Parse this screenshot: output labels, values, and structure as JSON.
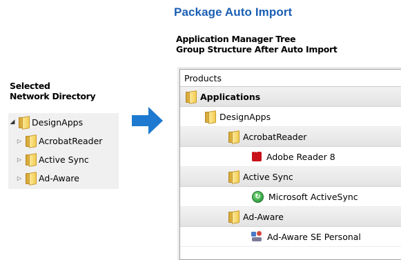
{
  "title": "Package Auto Import",
  "subtitle_lines": [
    "Application Manager Tree",
    "Group Structure After Auto Import"
  ],
  "left_heading_lines": [
    "Selected",
    "Network Directory"
  ],
  "left_tree": {
    "root": "DesignApps",
    "children": [
      "AcrobatReader",
      "Active Sync",
      "Ad-Aware"
    ]
  },
  "arrow_icon": "right-arrow-icon",
  "arrow_color": "#1e7ad0",
  "right_tree": {
    "header": "Products",
    "rows": [
      {
        "label": "Applications",
        "icon": "folder-icon"
      },
      {
        "label": "DesignApps",
        "icon": "folder-icon"
      },
      {
        "label": "AcrobatReader",
        "icon": "folder-icon"
      },
      {
        "label": "Adobe Reader 8",
        "icon": "adobe-reader-icon"
      },
      {
        "label": "Active Sync",
        "icon": "folder-icon"
      },
      {
        "label": "Microsoft ActiveSync",
        "icon": "activesync-icon"
      },
      {
        "label": "Ad-Aware",
        "icon": "folder-icon"
      },
      {
        "label": "Ad-Aware SE Personal",
        "icon": "adaware-icon"
      }
    ]
  }
}
